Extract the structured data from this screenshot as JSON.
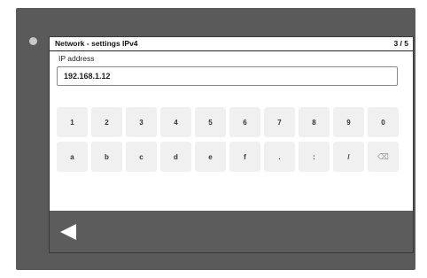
{
  "header": {
    "title": "Network - settings IPv4",
    "page_indicator": "3 / 5"
  },
  "form": {
    "ip_label": "IP address",
    "ip_value": "192.168.1.12"
  },
  "keypad": {
    "row1": [
      "1",
      "2",
      "3",
      "4",
      "5",
      "6",
      "7",
      "8",
      "9",
      "0"
    ],
    "row2": [
      "a",
      "b",
      "c",
      "d",
      "e",
      "f",
      ".",
      ":",
      "/",
      "⌫"
    ]
  },
  "nav": {
    "back_icon": "back-arrow-icon"
  },
  "colors": {
    "bezel": "#5a5a5a",
    "nav_bar": "#5c5c5c",
    "key_background": "#f0f0f0"
  }
}
